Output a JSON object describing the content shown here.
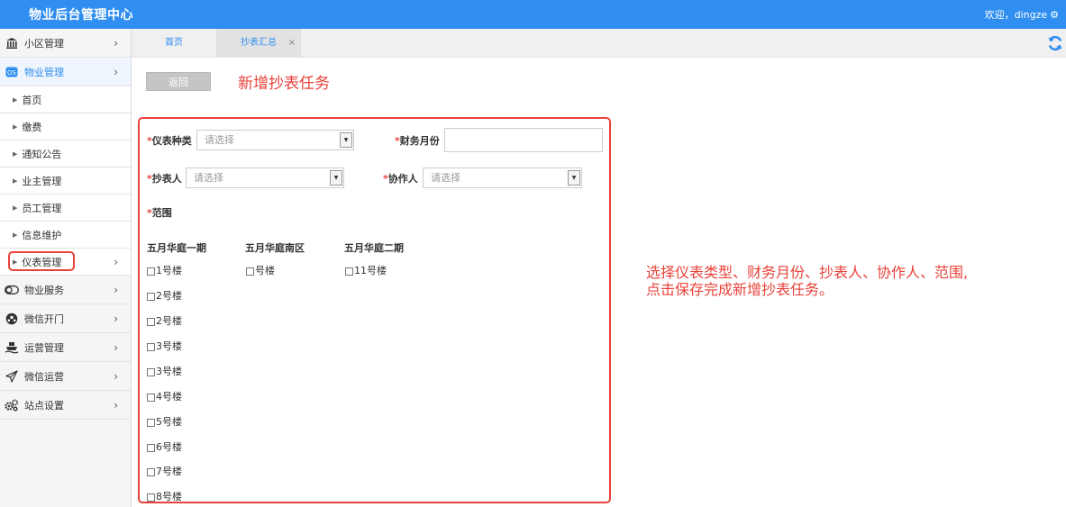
{
  "header": {
    "title": "物业后台管理中心",
    "welcome": "欢迎，dingze"
  },
  "sidebar": {
    "top_items": [
      {
        "label": "小区管理",
        "icon": "bank-icon"
      },
      {
        "label": "物业管理",
        "icon": "os-badge-icon"
      }
    ],
    "sub_items": [
      "首页",
      "缴费",
      "通知公告",
      "业主管理",
      "员工管理",
      "信息维护",
      "仪表管理"
    ],
    "bottom_items": [
      {
        "label": "物业服务",
        "icon": "toggle-icon"
      },
      {
        "label": "微信开门",
        "icon": "ball-icon"
      },
      {
        "label": "运营管理",
        "icon": "ship-icon"
      },
      {
        "label": "微信运营",
        "icon": "paper-plane-icon"
      },
      {
        "label": "站点设置",
        "icon": "gears-icon"
      }
    ]
  },
  "tabs": {
    "home": "首页",
    "meter_summary": "抄表汇总",
    "close_glyph": "×"
  },
  "main": {
    "back_label": "返回",
    "page_title": "新增抄表任务",
    "form": {
      "meter_type_label": "仪表种类",
      "meter_type_placeholder": "请选择",
      "finance_month_label": "财务月份",
      "reader_label": "抄表人",
      "reader_placeholder": "请选择",
      "assistant_label": "协作人",
      "assistant_placeholder": "请选择",
      "scope_label": "范围",
      "required_mark": "*"
    },
    "groups": [
      {
        "title": "五月华庭一期",
        "buildings": [
          "1号楼",
          "2号楼",
          "2号楼",
          "3号楼",
          "3号楼",
          "4号楼",
          "5号楼",
          "6号楼",
          "7号楼",
          "8号楼"
        ]
      },
      {
        "title": "五月华庭南区",
        "buildings": [
          "号楼"
        ]
      },
      {
        "title": "五月华庭二期",
        "buildings": [
          "11号楼"
        ]
      }
    ]
  },
  "annotation": {
    "line1": "选择仪表类型、财务月份、抄表人、协作人、范围,",
    "line2": "点击保存完成新增抄表任务。"
  },
  "colors": {
    "brand": "#2f8ef0",
    "highlight_red": "#e8423a"
  }
}
